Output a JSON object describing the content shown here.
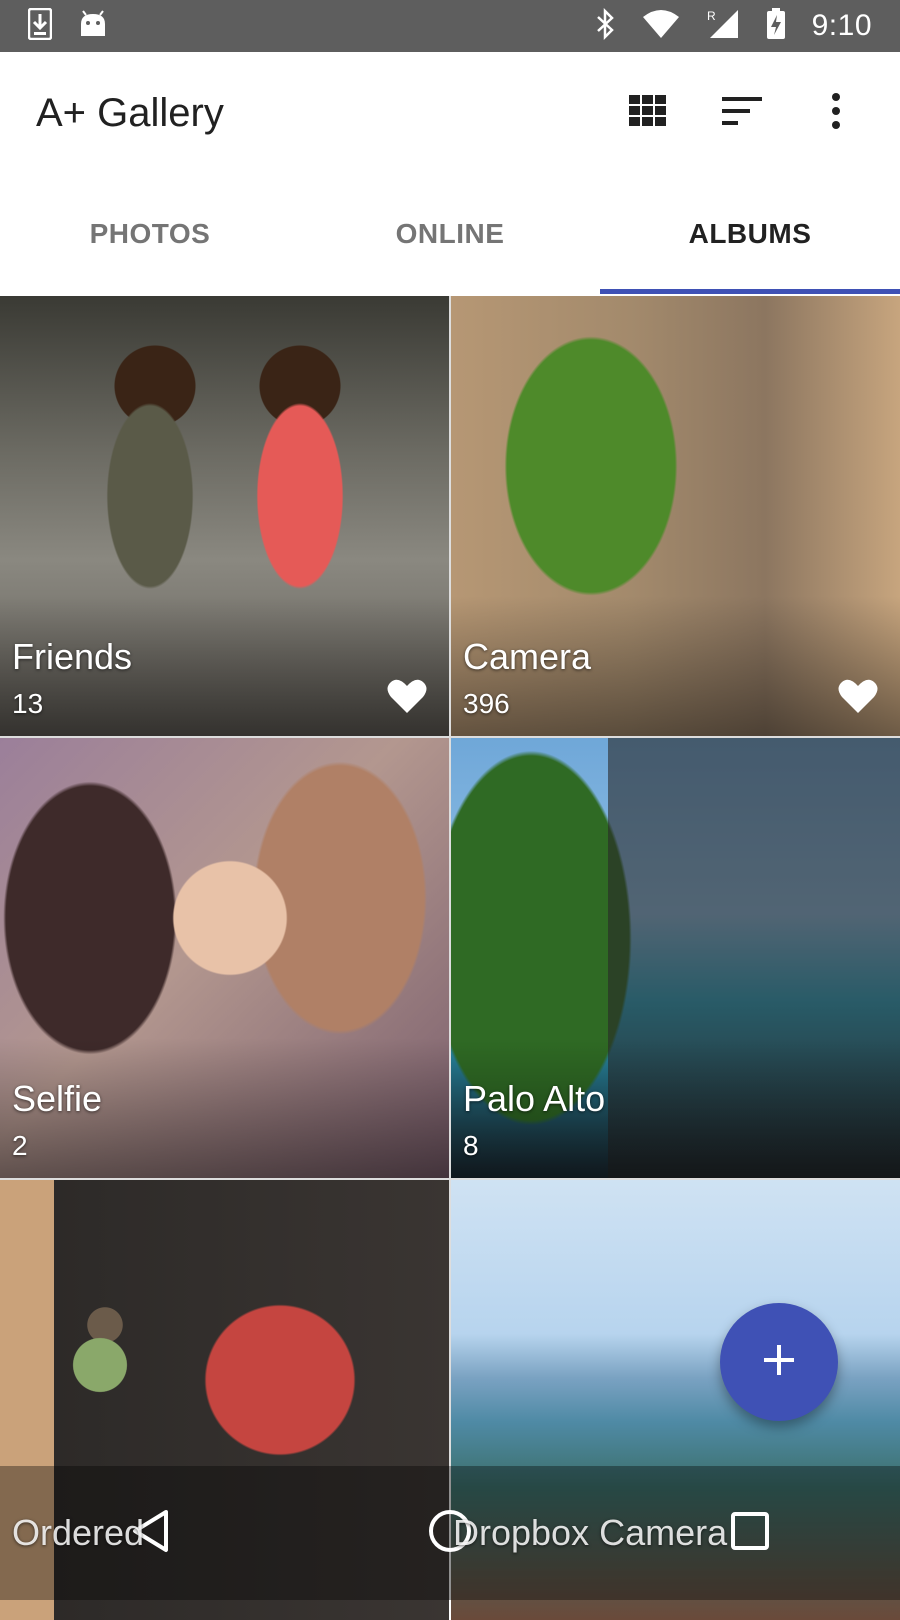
{
  "status_bar": {
    "time": "9:10",
    "icons": [
      "download-icon",
      "android-icon",
      "bluetooth-icon",
      "wifi-icon",
      "signal-roaming-icon",
      "battery-charging-icon"
    ]
  },
  "app_bar": {
    "title": "A+ Gallery",
    "actions": [
      "grid-view-icon",
      "sort-icon",
      "more-vert-icon"
    ]
  },
  "tabs": [
    {
      "label": "PHOTOS",
      "active": false
    },
    {
      "label": "ONLINE",
      "active": false
    },
    {
      "label": "ALBUMS",
      "active": true
    }
  ],
  "albums": [
    {
      "name": "Friends",
      "count": "13",
      "favorite": true
    },
    {
      "name": "Camera",
      "count": "396",
      "favorite": true
    },
    {
      "name": "Selfie",
      "count": "2",
      "favorite": false
    },
    {
      "name": "Palo Alto",
      "count": "8",
      "favorite": false
    },
    {
      "name": "Ordered",
      "count": "",
      "favorite": false
    },
    {
      "name": "Dropbox Camera",
      "count": "",
      "favorite": false
    }
  ],
  "fab": {
    "icon": "plus-icon"
  },
  "colors": {
    "accent": "#3f51b5",
    "status_bar": "#5e5e5e"
  }
}
